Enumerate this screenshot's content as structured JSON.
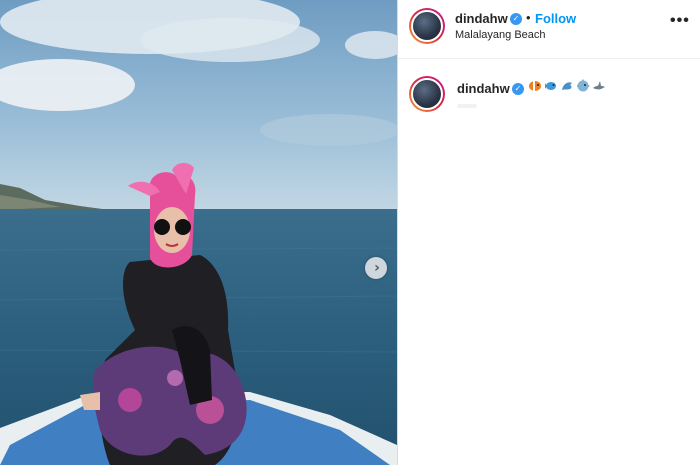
{
  "post": {
    "username": "dindahw",
    "separator": "•",
    "follow_label": "Follow",
    "location": "Malalayang Beach",
    "more_label": "•••"
  },
  "caption": {
    "username": "dindahw",
    "emoji_icons": [
      "clownfish-icon",
      "fish-icon",
      "dolphin-icon",
      "blowfish-icon",
      "shark-icon"
    ]
  },
  "carousel": {
    "next_glyph": "›"
  },
  "colors": {
    "follow_blue": "#0095f6",
    "verified_blue": "#3897f0",
    "text": "#262626",
    "divider": "#dbdbdb"
  }
}
